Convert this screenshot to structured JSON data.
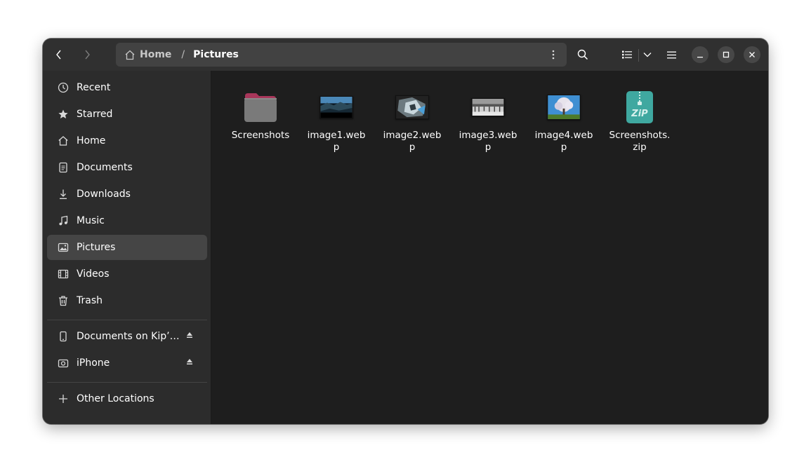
{
  "nav": {
    "back_label": "Back",
    "forward_label": "Forward"
  },
  "pathbar": {
    "home_label": "Home",
    "separator": "/",
    "current_label": "Pictures"
  },
  "sidebar": {
    "places": [
      {
        "label": "Recent",
        "icon": "clock-icon"
      },
      {
        "label": "Starred",
        "icon": "star-icon"
      },
      {
        "label": "Home",
        "icon": "home-icon"
      },
      {
        "label": "Documents",
        "icon": "document-icon"
      },
      {
        "label": "Downloads",
        "icon": "download-icon"
      },
      {
        "label": "Music",
        "icon": "music-note-icon"
      },
      {
        "label": "Pictures",
        "icon": "picture-icon",
        "active": true
      },
      {
        "label": "Videos",
        "icon": "film-icon"
      },
      {
        "label": "Trash",
        "icon": "trash-icon"
      }
    ],
    "devices": [
      {
        "label": "Documents on Kip’s iPhone",
        "icon": "phone-icon",
        "eject": true
      },
      {
        "label": "iPhone",
        "icon": "camera-icon",
        "eject": true
      }
    ],
    "other": {
      "label": "Other Locations",
      "icon": "plus-icon"
    }
  },
  "files": [
    {
      "name": "Screenshots",
      "type": "folder",
      "icon": "folder-icon"
    },
    {
      "name": "image1.webp",
      "type": "image"
    },
    {
      "name": "image2.webp",
      "type": "image"
    },
    {
      "name": "image3.webp",
      "type": "image"
    },
    {
      "name": "image4.webp",
      "type": "image"
    },
    {
      "name": "Screenshots.zip",
      "type": "archive",
      "icon": "zip-archive-icon"
    }
  ],
  "colors": {
    "window_bg": "#1e1e1e",
    "header_bg": "#303030",
    "sidebar_bg": "#2c2c2c",
    "active_item_bg": "#454545",
    "folder_accent": "#a8365a",
    "zip_accent": "#3fa8a0"
  }
}
